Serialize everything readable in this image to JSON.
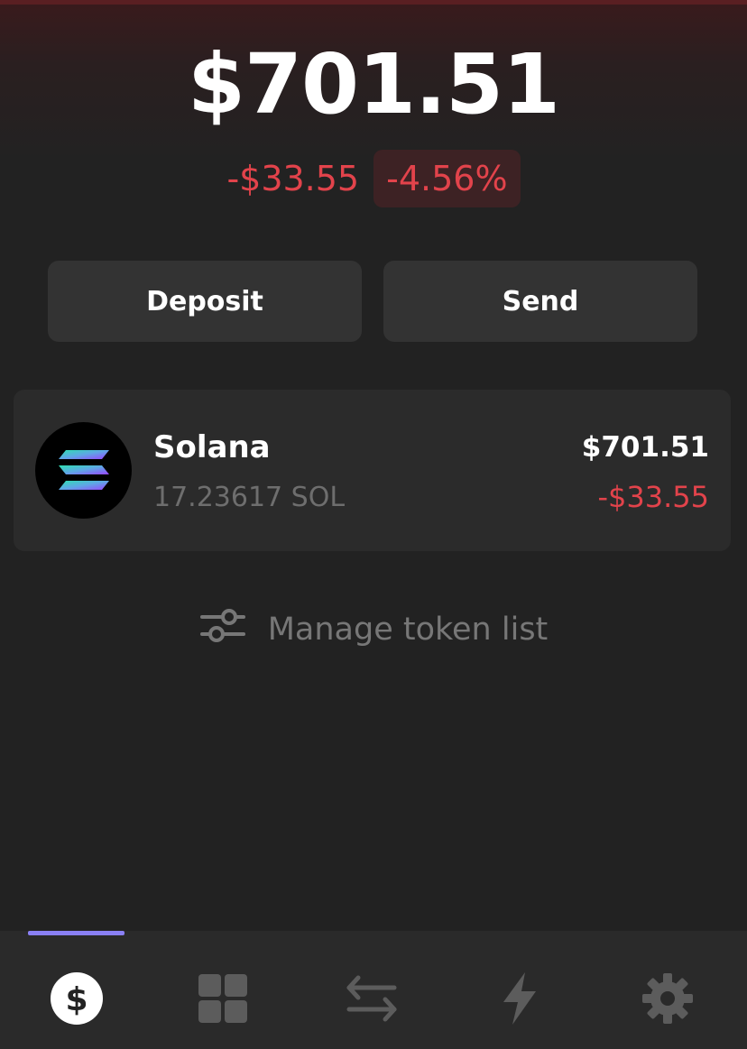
{
  "portfolio": {
    "balance": "$701.51",
    "change_amount": "-$33.55",
    "change_percent": "-4.56%",
    "negative_color": "#e2434b"
  },
  "actions": {
    "deposit_label": "Deposit",
    "send_label": "Send"
  },
  "tokens": [
    {
      "icon": "solana-logo",
      "name": "Solana",
      "amount": "17.23617 SOL",
      "value": "$701.51",
      "change": "-$33.55"
    }
  ],
  "manage": {
    "icon": "sliders-icon",
    "label": "Manage token list"
  },
  "nav": {
    "active_index": 0,
    "accent_color": "#8a80f5",
    "items": [
      {
        "icon": "dollar-icon"
      },
      {
        "icon": "grid-icon"
      },
      {
        "icon": "swap-icon"
      },
      {
        "icon": "lightning-icon"
      },
      {
        "icon": "gear-icon"
      }
    ]
  }
}
